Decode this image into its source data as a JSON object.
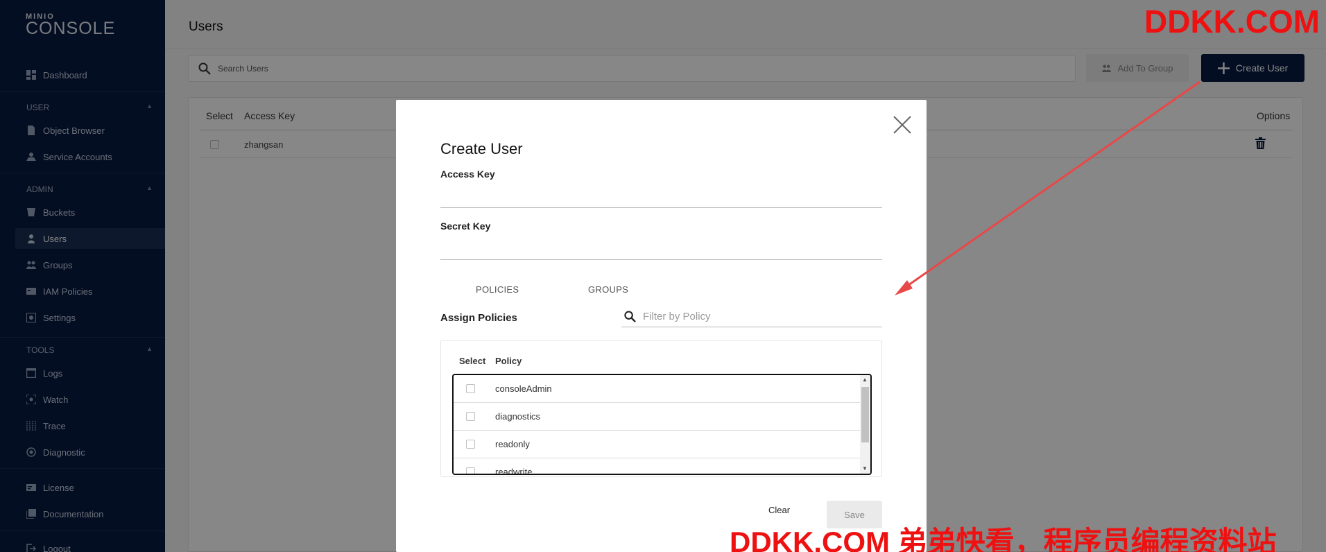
{
  "sidebar": {
    "logo_top": "MINIO",
    "logo_main": "CONSOLE",
    "items": [
      {
        "label": "Dashboard"
      },
      {
        "label": "Object Browser"
      },
      {
        "label": "Service Accounts"
      },
      {
        "label": "Buckets"
      },
      {
        "label": "Users"
      },
      {
        "label": "Groups"
      },
      {
        "label": "IAM Policies"
      },
      {
        "label": "Settings"
      },
      {
        "label": "Logs"
      },
      {
        "label": "Watch"
      },
      {
        "label": "Trace"
      },
      {
        "label": "Diagnostic"
      },
      {
        "label": "License"
      },
      {
        "label": "Documentation"
      },
      {
        "label": "Logout"
      }
    ],
    "sections": {
      "user": "USER",
      "admin": "ADMIN",
      "tools": "TOOLS"
    },
    "active_item": "Users"
  },
  "header": {
    "title": "Users"
  },
  "search": {
    "placeholder": "Search Users"
  },
  "toolbar": {
    "add_to_group_label": "Add To Group",
    "create_user_label": "Create User"
  },
  "users_table": {
    "columns": [
      "Select",
      "Access Key",
      "Options"
    ],
    "rows": [
      {
        "access_key": "zhangsan"
      }
    ]
  },
  "modal": {
    "title": "Create User",
    "access_key_label": "Access Key",
    "access_key_value": "",
    "secret_key_label": "Secret Key",
    "secret_key_value": "",
    "tabs": [
      "POLICIES",
      "GROUPS"
    ],
    "assign_label": "Assign Policies",
    "filter_placeholder": "Filter by Policy",
    "policy_columns": [
      "Select",
      "Policy"
    ],
    "policies": [
      "consoleAdmin",
      "diagnostics",
      "readonly",
      "readwrite"
    ],
    "clear_label": "Clear",
    "save_label": "Save"
  },
  "watermarks": {
    "top": "DDKK.COM",
    "bottom": "DDKK.COM 弟弟快看，程序员编程资料站"
  },
  "colors": {
    "sidebar_bg": "#081c42",
    "primary_button": "#081c42",
    "watermark": "#ee1111",
    "arrow": "#e84848"
  }
}
